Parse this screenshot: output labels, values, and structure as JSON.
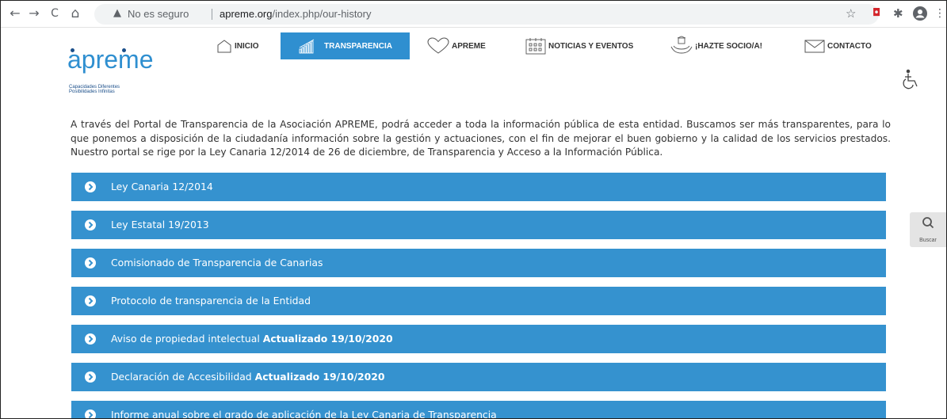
{
  "browser": {
    "back": "←",
    "forward": "→",
    "reload": "C",
    "home": "⌂",
    "security_text": "No es seguro",
    "url_domain": "apreme.org",
    "url_path": "/index.php/our-history"
  },
  "site": {
    "logo_text": "apreme",
    "logo_tagline_1": "Capacidades Diferentes",
    "logo_tagline_2": "Posibilidades Infinitas",
    "accent": "#2f8fd0",
    "menu": [
      {
        "label": "INICIO",
        "icon": "house-icon"
      },
      {
        "label": "TRANSPARENCIA",
        "icon": "bar-chart-icon",
        "active": true
      },
      {
        "label": "APREME",
        "icon": "heart-icon"
      },
      {
        "label": "NOTICIAS Y EVENTOS",
        "icon": "calendar-icon"
      },
      {
        "label": "¡HAZTE SOCIO/A!",
        "icon": "hands-icon"
      },
      {
        "label": "CONTACTO",
        "icon": "mail-icon"
      }
    ],
    "intro": "A través del Portal de Transparencia de la Asociación APREME, podrá acceder a toda la información pública de esta entidad. Buscamos ser más transparentes, para lo que ponemos a disposición de la ciudadanía información sobre la gestión y actuaciones, con el fin de mejorar el buen gobierno y la calidad de los servicios prestados. Nuestro portal se rige por la Ley Canaria 12/2014 de 26 de diciembre, de Transparencia y Acceso a la Información Pública.",
    "accordion": [
      {
        "label": "Ley Canaria 12/2014",
        "bold": ""
      },
      {
        "label": "Ley Estatal 19/2013",
        "bold": ""
      },
      {
        "label": "Comisionado de Transparencia de Canarias",
        "bold": ""
      },
      {
        "label": "Protocolo de transparencia de la Entidad",
        "bold": ""
      },
      {
        "label": "Aviso de propiedad intelectual ",
        "bold": "Actualizado 19/10/2020"
      },
      {
        "label": "Declaración de Accesibilidad ",
        "bold": "Actualizado 19/10/2020"
      },
      {
        "label": "Informe anual sobre el grado de aplicación de la Ley Canaria de Transparencia",
        "bold": ""
      }
    ],
    "search_label": "Buscar"
  }
}
